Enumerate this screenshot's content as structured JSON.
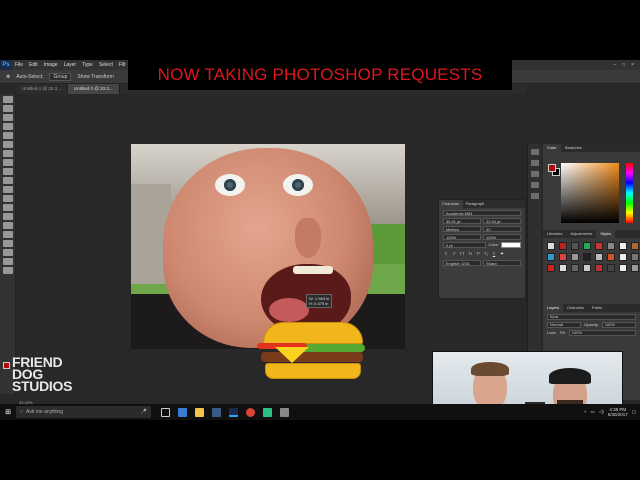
{
  "banner": {
    "text": "NOW TAKING PHOTOSHOP REQUESTS"
  },
  "menubar": {
    "logo": "Ps",
    "items": [
      "File",
      "Edit",
      "Image",
      "Layer",
      "Type",
      "Select",
      "Filt"
    ]
  },
  "optionsbar": {
    "auto_select": "Auto-Select:",
    "auto_select_value": "Group",
    "show_transform": "Show Transform"
  },
  "doctabs": [
    "Untitled-1 @ 25.3...",
    "Untitled-2 @ 33.3..."
  ],
  "character_panel": {
    "tabs": [
      "Character",
      "Paragraph"
    ],
    "font": "Academic M54",
    "size": "35.91 pt",
    "leading": "22.94 pt",
    "kerning": "Metrics",
    "tracking": "40",
    "vscale": "100%",
    "hscale": "100%",
    "baseline": "0 pt",
    "color_label": "Color:",
    "language": "English: USA",
    "aa": "Sharp"
  },
  "cursor_tip": {
    "w": "W: 1.963 in",
    "h": "H: 0.479 in"
  },
  "right_panels": {
    "color_tabs": [
      "Color",
      "Swatches"
    ],
    "style_tabs": [
      "Libraries",
      "Adjustments",
      "Styles"
    ],
    "layer_tabs": [
      "Layers",
      "Channels",
      "Paths"
    ],
    "layer_kind": "Kind",
    "blend_mode": "Normal",
    "opacity_label": "Opacity:",
    "opacity": "100%",
    "lock_label": "Lock:",
    "fill_label": "Fill:",
    "fill": "100%"
  },
  "logo": {
    "line1": "FRIEND",
    "line2": "DOG",
    "line3": "STUDIOS"
  },
  "ps_status": "33.33%",
  "taskbar": {
    "search_placeholder": "Ask me anything",
    "time": "4:38 PM",
    "date": "5/30/2017"
  },
  "colors": {
    "banner_red": "#e0161c",
    "foreground": "#b10b0b"
  }
}
